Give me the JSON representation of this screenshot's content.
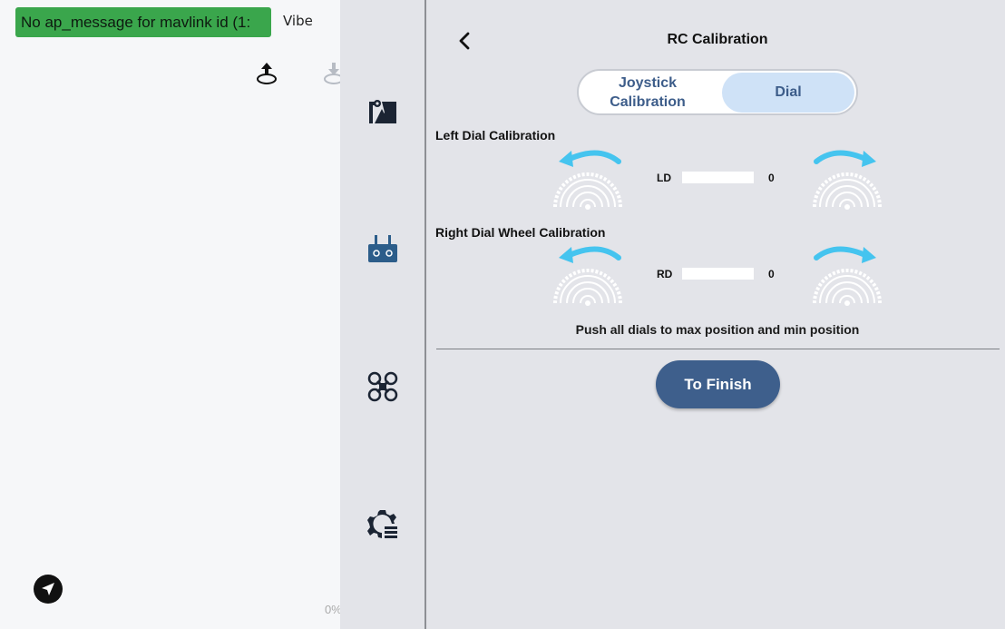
{
  "map_pane": {
    "status_message": "No ap_message for mavlink id (1:",
    "vibe_label": "Vibe",
    "percent_label": "0%"
  },
  "panel": {
    "title": "RC Calibration",
    "tabs": {
      "joystick": "Joystick Calibration",
      "dial": "Dial",
      "selected": "dial"
    },
    "left_dial": {
      "title": "Left Dial Calibration",
      "channel_label": "LD",
      "value": "0"
    },
    "right_dial": {
      "title": "Right Dial Wheel Calibration",
      "channel_label": "RD",
      "value": "0"
    },
    "instruction": "Push all dials to max position and min position",
    "finish_label": "To Finish"
  },
  "colors": {
    "status_green": "#3aa64c",
    "accent_blue": "#3e5f8c",
    "arrow_cyan": "#45c4ef",
    "tab_selected": "#cfe2f7"
  },
  "icons": [
    "upload-icon",
    "download-icon",
    "send-icon",
    "map-icon",
    "remote-controller-icon",
    "drone-icon",
    "settings-icon",
    "back-chevron-icon",
    "arrow-counterclockwise-icon",
    "arrow-clockwise-icon",
    "dial-wheel-icon"
  ]
}
